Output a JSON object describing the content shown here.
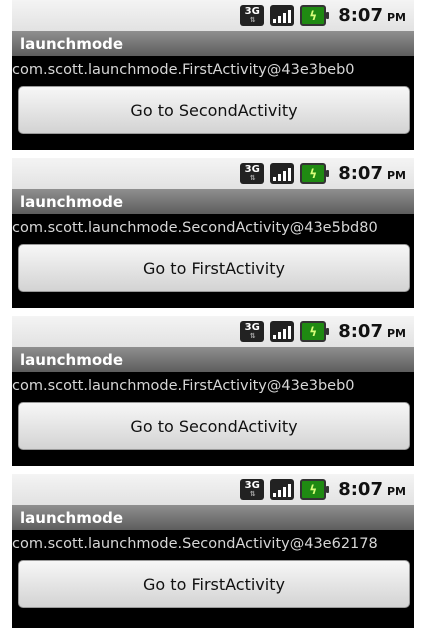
{
  "status": {
    "network": "3G",
    "time": "8:07",
    "ampm": "PM"
  },
  "screens": [
    {
      "title": "launchmode",
      "activity": "com.scott.launchmode.FirstActivity@43e3beb0",
      "button": "Go to SecondActivity"
    },
    {
      "title": "launchmode",
      "activity": "com.scott.launchmode.SecondActivity@43e5bd80",
      "button": "Go to FirstActivity"
    },
    {
      "title": "launchmode",
      "activity": "com.scott.launchmode.FirstActivity@43e3beb0",
      "button": "Go to SecondActivity"
    },
    {
      "title": "launchmode",
      "activity": "com.scott.launchmode.SecondActivity@43e62178",
      "button": "Go to FirstActivity"
    }
  ]
}
